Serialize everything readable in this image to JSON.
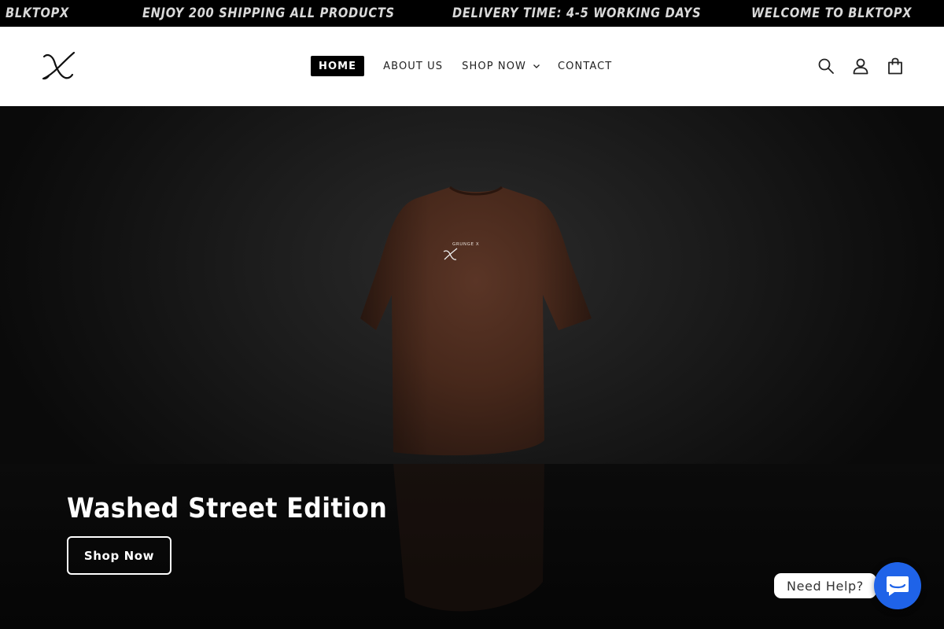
{
  "announcement": {
    "messages": [
      "BLKTOPX",
      "ENJOY 200 SHIPPING ALL PRODUCTS",
      "DELIVERY TIME: 4-5 WORKING DAYS",
      "WELCOME TO BLKTOPX"
    ]
  },
  "header": {
    "logo_icon": "x-script-logo",
    "nav": [
      {
        "label": "HOME",
        "active": true
      },
      {
        "label": "ABOUT US"
      },
      {
        "label": "SHOP NOW",
        "has_dropdown": true
      },
      {
        "label": "CONTACT"
      }
    ],
    "icons": [
      "search-icon",
      "account-icon",
      "cart-icon"
    ]
  },
  "hero": {
    "title": "Washed Street Edition",
    "button_label": "Shop Now",
    "product_print": "GRUNGE X"
  },
  "help_widget": {
    "label": "Need Help?",
    "icon": "chat-icon",
    "accent": "#1f63e8"
  },
  "colors": {
    "announcement_bg": "#000000",
    "header_bg": "#ffffff",
    "tshirt": "#4a2a1c"
  }
}
